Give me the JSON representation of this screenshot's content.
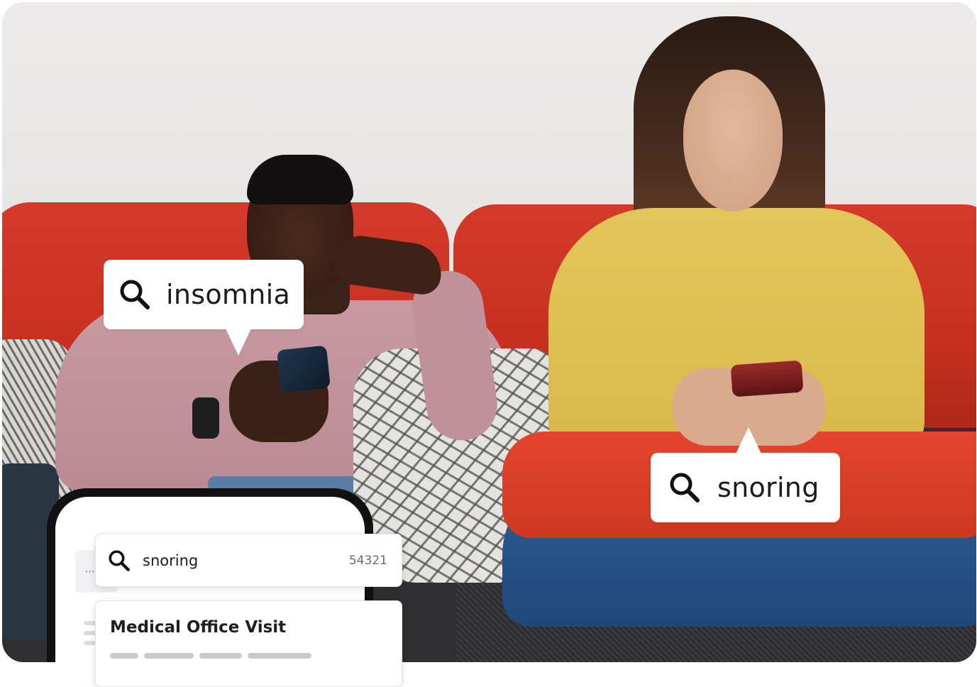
{
  "callouts": {
    "insomnia": {
      "icon": "search-icon",
      "text": "insomnia"
    },
    "snoring": {
      "icon": "search-icon",
      "text": "snoring"
    }
  },
  "device": {
    "search": {
      "icon": "search-icon",
      "query": "snoring",
      "count": "54321"
    },
    "result": {
      "title": "Medical Office Visit"
    }
  },
  "colors": {
    "bubble_bg": "#ffffff",
    "text": "#1b1b1b",
    "sofa_red": "#c8301f",
    "device_frame": "#111111"
  }
}
